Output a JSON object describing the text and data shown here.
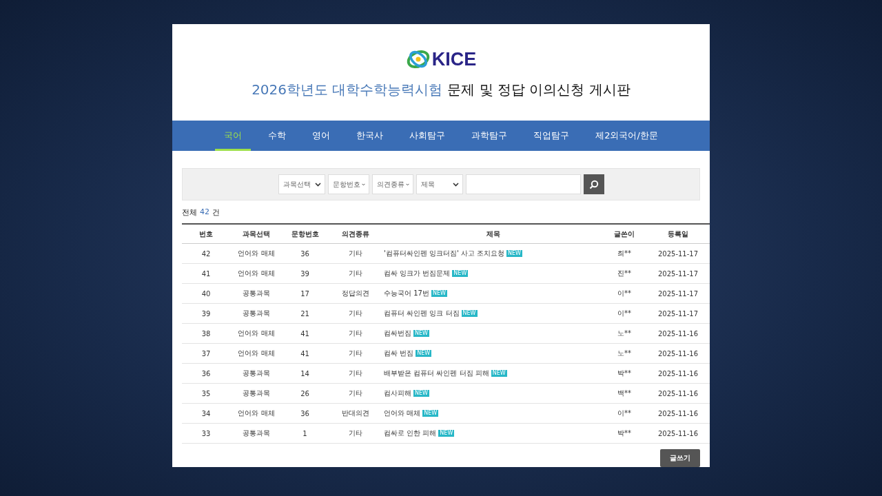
{
  "logo": {
    "text": "KICE"
  },
  "title": {
    "highlight": "2026학년도 대학수학능력시험",
    "rest": "문제 및 정답 이의신청 게시판"
  },
  "tabs": [
    {
      "label": "국어",
      "selected": true
    },
    {
      "label": "수학",
      "selected": false
    },
    {
      "label": "영어",
      "selected": false
    },
    {
      "label": "한국사",
      "selected": false
    },
    {
      "label": "사회탐구",
      "selected": false
    },
    {
      "label": "과학탐구",
      "selected": false
    },
    {
      "label": "직업탐구",
      "selected": false
    },
    {
      "label": "제2외국어/한문",
      "selected": false
    }
  ],
  "search": {
    "selects": [
      "과목선택",
      "문항번호",
      "의견종류",
      "제목"
    ]
  },
  "count": {
    "prefix": "전체",
    "number": "42",
    "suffix": "건"
  },
  "table": {
    "columns": [
      "번호",
      "과목선택",
      "문항번호",
      "의견종류",
      "제목",
      "글쓴이",
      "등록일"
    ],
    "rows": [
      {
        "no": "42",
        "subject": "언어와 매체",
        "item": "36",
        "type": "기타",
        "title": "'컴퓨터싸인펜 잉크터짐' 사고 조치요청",
        "badge": "NEW",
        "writer": "최**",
        "date": "2025-11-17"
      },
      {
        "no": "41",
        "subject": "언어와 매체",
        "item": "39",
        "type": "기타",
        "title": "컴싸 잉크가 번짐문제",
        "badge": "NEW",
        "writer": "진**",
        "date": "2025-11-17"
      },
      {
        "no": "40",
        "subject": "공통과목",
        "item": "17",
        "type": "정답의견",
        "title": "수능국어 17번",
        "badge": "NEW",
        "writer": "이**",
        "date": "2025-11-17"
      },
      {
        "no": "39",
        "subject": "공통과목",
        "item": "21",
        "type": "기타",
        "title": "컴퓨터 싸인펜 잉크 터짐",
        "badge": "NEW",
        "writer": "이**",
        "date": "2025-11-17"
      },
      {
        "no": "38",
        "subject": "언어와 매체",
        "item": "41",
        "type": "기타",
        "title": "컴싸번짐",
        "badge": "NEW",
        "writer": "노**",
        "date": "2025-11-16"
      },
      {
        "no": "37",
        "subject": "언어와 매체",
        "item": "41",
        "type": "기타",
        "title": "컴싸 번짐",
        "badge": "NEW",
        "writer": "노**",
        "date": "2025-11-16"
      },
      {
        "no": "36",
        "subject": "공통과목",
        "item": "14",
        "type": "기타",
        "title": "배부받은 컴퓨터 싸인펜 터짐 피해",
        "badge": "NEW",
        "writer": "박**",
        "date": "2025-11-16"
      },
      {
        "no": "35",
        "subject": "공통과목",
        "item": "26",
        "type": "기타",
        "title": "컴사피해",
        "badge": "NEW",
        "writer": "백**",
        "date": "2025-11-16"
      },
      {
        "no": "34",
        "subject": "언어와 매체",
        "item": "36",
        "type": "반대의견",
        "title": "언어와 매체",
        "badge": "NEW",
        "writer": "이**",
        "date": "2025-11-16"
      },
      {
        "no": "33",
        "subject": "공통과목",
        "item": "1",
        "type": "기타",
        "title": "컴싸로 인한 피해",
        "badge": "NEW",
        "writer": "박**",
        "date": "2025-11-16"
      }
    ]
  },
  "write_button": "글쓰기"
}
